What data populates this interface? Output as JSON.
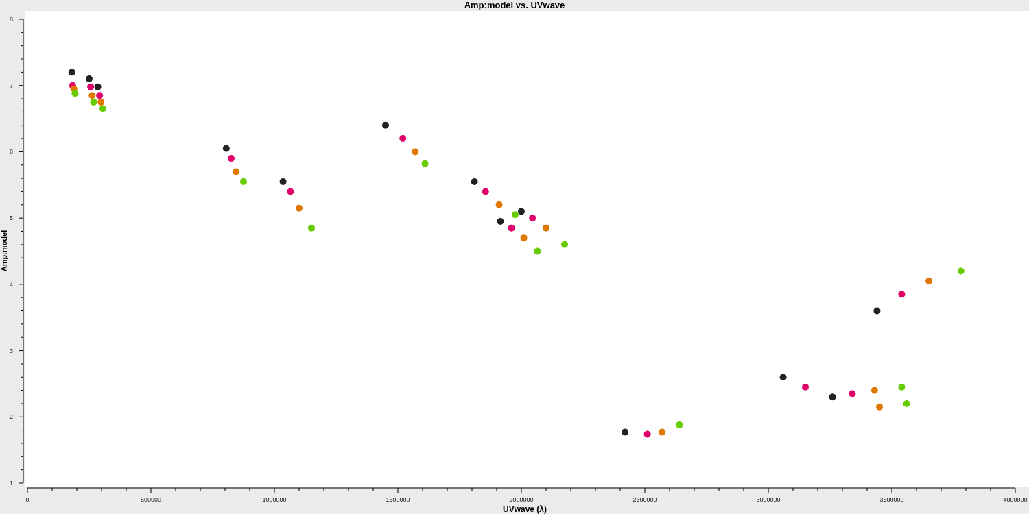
{
  "chart_data": {
    "type": "scatter",
    "title": "Amp:model vs. UVwave",
    "xlabel": "UVwave (λ)",
    "ylabel": "Amp:model",
    "xlim": [
      0,
      4000000
    ],
    "ylim": [
      1,
      8
    ],
    "xticks": [
      0,
      500000,
      1000000,
      1500000,
      2000000,
      2500000,
      3000000,
      3500000,
      4000000
    ],
    "yticks": [
      1,
      2,
      3,
      4,
      5,
      6,
      7,
      8
    ],
    "series": [
      {
        "color": "#222222",
        "x": [
          180000,
          250000,
          285000,
          805000,
          1035000,
          1450000,
          1810000,
          1915000,
          2000000,
          2420000,
          3440000,
          3060000,
          3260000
        ],
        "values": [
          7.2,
          7.1,
          6.98,
          6.05,
          5.55,
          6.4,
          5.55,
          4.95,
          5.1,
          1.77,
          3.6,
          2.6,
          2.3
        ]
      },
      {
        "color": "#e0006a",
        "x": [
          183000,
          256000,
          292000,
          825000,
          1065000,
          1520000,
          1855000,
          1960000,
          2045000,
          2510000,
          3540000,
          3150000,
          3340000
        ],
        "values": [
          7.0,
          6.98,
          6.85,
          5.9,
          5.4,
          6.2,
          5.4,
          4.85,
          5.0,
          1.74,
          3.85,
          2.45,
          2.35
        ]
      },
      {
        "color": "#e07800",
        "x": [
          188000,
          262000,
          298000,
          845000,
          1100000,
          1570000,
          1910000,
          2010000,
          2100000,
          2570000,
          3650000,
          3430000,
          3450000
        ],
        "values": [
          6.95,
          6.85,
          6.75,
          5.7,
          5.15,
          6.0,
          5.2,
          4.7,
          4.85,
          1.77,
          4.05,
          2.4,
          2.15
        ]
      },
      {
        "color": "#66cc00",
        "x": [
          193000,
          268000,
          305000,
          875000,
          1150000,
          1610000,
          1975000,
          2065000,
          2175000,
          2640000,
          3780000,
          3540000,
          3560000
        ],
        "values": [
          6.88,
          6.75,
          6.65,
          5.55,
          4.85,
          5.82,
          5.05,
          4.5,
          4.6,
          1.88,
          4.2,
          2.45,
          2.2
        ]
      }
    ]
  }
}
